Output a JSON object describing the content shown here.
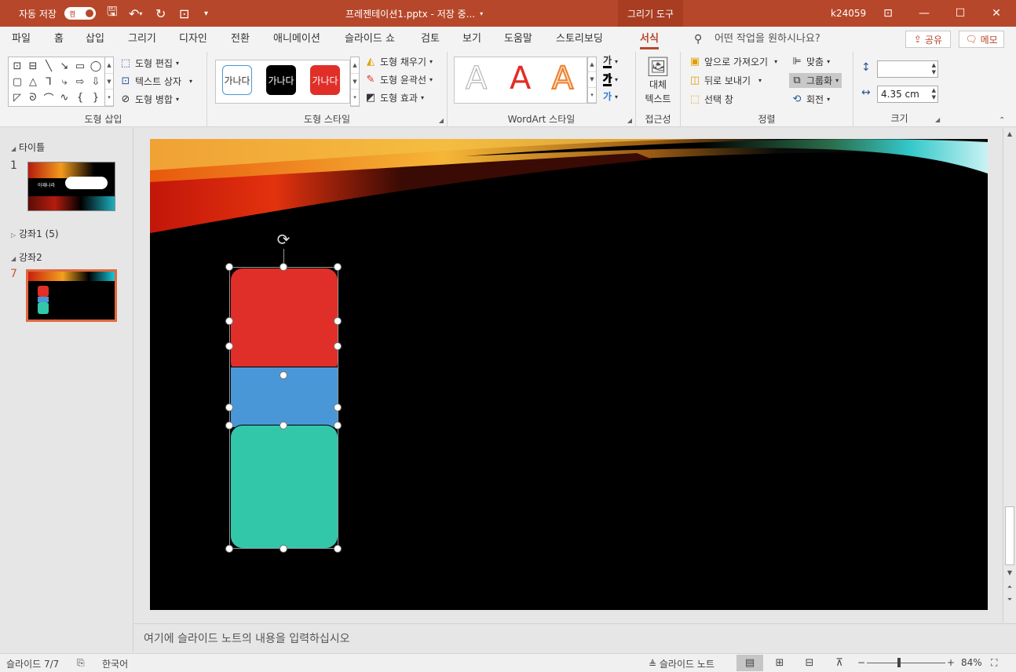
{
  "titlebar": {
    "autosave_label": "자동 저장",
    "autosave_state": "켬",
    "title": "프레젠테이션1.pptx  -  저장 중...",
    "context_tab": "그리기 도구",
    "user": "k24059"
  },
  "tabs": [
    "파일",
    "홈",
    "삽입",
    "그리기",
    "디자인",
    "전환",
    "애니메이션",
    "슬라이드 쇼",
    "검토",
    "보기",
    "도움말",
    "스토리보딩",
    "서식"
  ],
  "active_tab": "서식",
  "search_placeholder": "어떤 작업을 원하시나요?",
  "share_label": "공유",
  "memo_label": "메모",
  "ribbon": {
    "insert_shapes": {
      "label": "도형 삽입",
      "edit_shape": "도형 편집",
      "text_box": "텍스트 상자",
      "merge_shapes": "도형 병합"
    },
    "shape_styles": {
      "label": "도형 스타일",
      "swatch_text": "가나다",
      "fill": "도형 채우기",
      "outline": "도형 윤곽선",
      "effects": "도형 효과"
    },
    "wordart": {
      "label": "WordArt 스타일",
      "glyph": "A",
      "text_glyph": "가"
    },
    "accessibility": {
      "label": "접근성",
      "alt_text_line1": "대체",
      "alt_text_line2": "텍스트"
    },
    "arrange": {
      "label": "정렬",
      "bring_forward": "앞으로 가져오기",
      "send_backward": "뒤로 보내기",
      "selection_pane": "선택 창",
      "align": "맞춤",
      "group": "그룹화",
      "rotate": "회전"
    },
    "size": {
      "label": "크기",
      "height": "",
      "width": "4.35 cm"
    }
  },
  "slides_panel": {
    "sections": [
      {
        "name": "타이틀"
      },
      {
        "name": "강좌1 (5)"
      },
      {
        "name": "강좌2"
      }
    ],
    "slide_numbers": [
      "1",
      "7"
    ],
    "thumb1_text": "아재나라"
  },
  "notes_placeholder": "여기에 슬라이드 노트의 내용을 입력하십시오",
  "status": {
    "slide_indicator": "슬라이드 7/7",
    "language": "한국어",
    "notes_button": "슬라이드 노트",
    "zoom": "84%"
  },
  "colors": {
    "accent": "#b7472a",
    "red_shape": "#e02f28",
    "blue_shape": "#4a97d8",
    "green_shape": "#33c7aa"
  }
}
